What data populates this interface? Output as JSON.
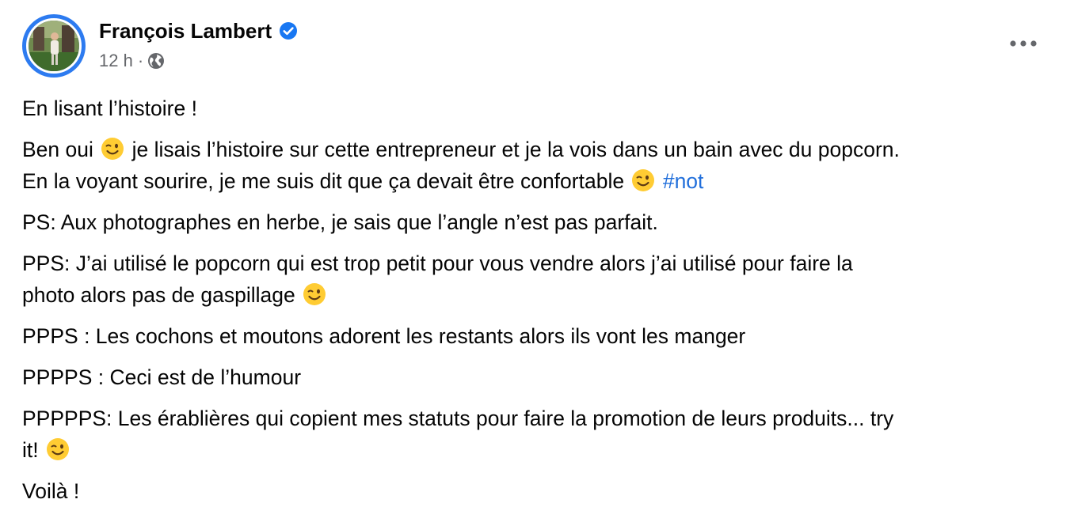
{
  "author": {
    "name": "François Lambert",
    "avatar_icon": "profile-photo",
    "verified_icon": "verified-badge-icon"
  },
  "meta": {
    "time": "12 h",
    "separator": "·",
    "privacy_icon": "globe-icon"
  },
  "menu_icon": "more-options-icon",
  "colors": {
    "accent": "#216fdb",
    "secondary_text": "#65676b",
    "primary_text": "#050505",
    "avatar_ring": "#2d7bf0"
  },
  "post": {
    "p1": "En lisant l’histoire !",
    "p2a": "Ben oui ",
    "p2b": " je lisais l’histoire sur cette entrepreneur et je la vois dans un bain avec du popcorn.",
    "p2c": "En la voyant sourire, je me suis dit que ça devait être confortable ",
    "p2_hashtag": "#not",
    "p3": "PS: Aux photographes en herbe, je sais que l’angle n’est pas parfait.",
    "p4a": "PPS: J’ai utilisé le popcorn qui est trop petit pour vous vendre alors j’ai utilisé pour faire la",
    "p4b": "photo alors pas de gaspillage ",
    "p5": "PPPS : Les cochons et moutons adorent les restants alors ils vont les manger",
    "p6": "PPPPS : Ceci est de l’humour",
    "p7a": "PPPPPS: Les érablières qui copient mes statuts pour faire la promotion de leurs produits... try",
    "p7b": "it! ",
    "p8": "Voilà !",
    "emoji_name": "winking-face-emoji"
  }
}
